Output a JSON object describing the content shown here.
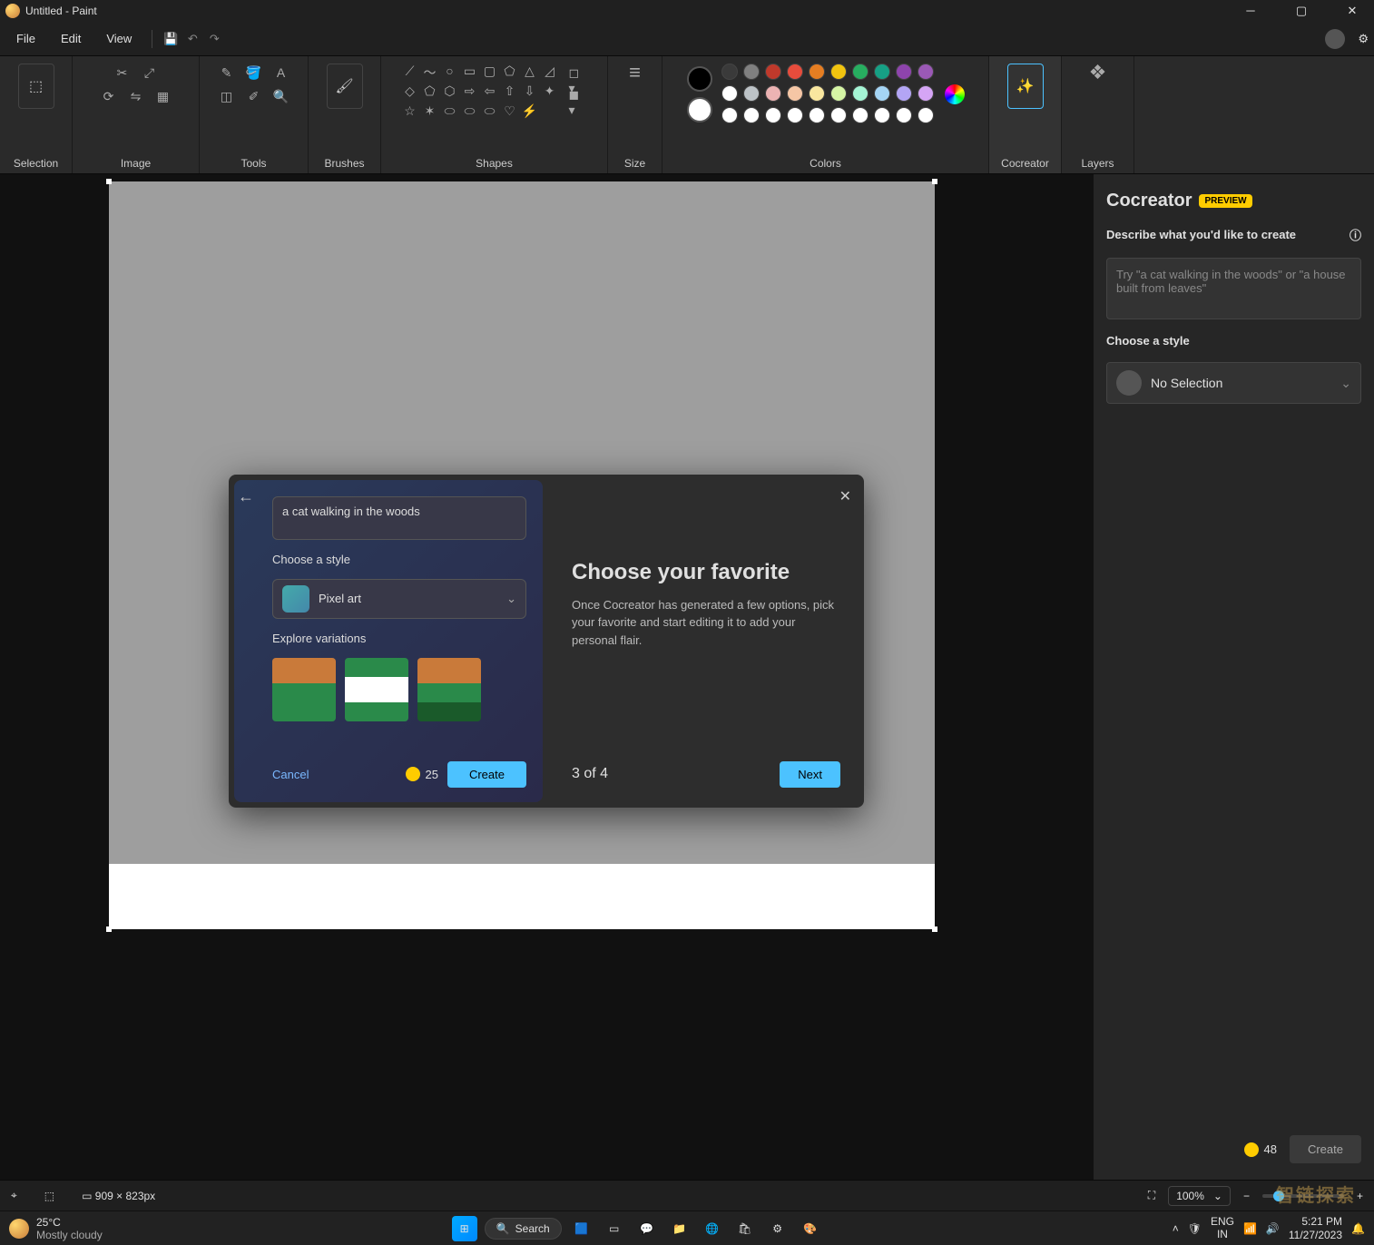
{
  "window": {
    "title": "Untitled - Paint"
  },
  "menubar": {
    "file": "File",
    "edit": "Edit",
    "view": "View"
  },
  "ribbon": {
    "selection": "Selection",
    "image": "Image",
    "tools": "Tools",
    "brushes": "Brushes",
    "shapes": "Shapes",
    "size": "Size",
    "colors": "Colors",
    "cocreator": "Cocreator",
    "layers": "Layers"
  },
  "ribbon_colors": {
    "selected1": "#000000",
    "selected2": "#ffffff",
    "row1": [
      "#3a3a3a",
      "#808080",
      "#c0392b",
      "#e74c3c",
      "#e67e22",
      "#f1c40f",
      "#27ae60",
      "#16a085",
      "#8e44ad",
      "#9b59b6"
    ],
    "row2": [
      "#ffffff",
      "#bdc3c7",
      "#ecb3b3",
      "#f5c6a5",
      "#f9e79f",
      "#d5f5a5",
      "#a5f5d5",
      "#a5d5f5",
      "#b3a5f5",
      "#d5a5f5"
    ],
    "row3": [
      "#ffffff",
      "#ffffff",
      "#ffffff",
      "#ffffff",
      "#ffffff",
      "#ffffff",
      "#ffffff",
      "#ffffff",
      "#ffffff",
      "#ffffff"
    ]
  },
  "cocreator_panel": {
    "title": "Cocreator",
    "badge": "PREVIEW",
    "prompt_label": "Describe what you'd like to create",
    "placeholder": "Try \"a cat walking in the woods\" or \"a house built from leaves\"",
    "style_label": "Choose a style",
    "style_value": "No Selection",
    "credits": "48",
    "create": "Create"
  },
  "modal": {
    "prompt_value": "a cat walking in the woods",
    "style_label": "Choose a style",
    "style_value": "Pixel art",
    "explore": "Explore variations",
    "cancel": "Cancel",
    "credits": "25",
    "create": "Create",
    "right_title": "Choose your favorite",
    "right_body": "Once Cocreator has generated a few options, pick your favorite and start editing it to add your personal flair.",
    "step": "3 of 4",
    "next": "Next"
  },
  "statusbar": {
    "cursor_icon": "⌖",
    "dims": "909 × 823px",
    "zoom": "100%"
  },
  "taskbar": {
    "temp": "25°C",
    "cond": "Mostly cloudy",
    "search": "Search",
    "lang1": "ENG",
    "lang2": "IN",
    "time": "5:21 PM",
    "date": "11/27/2023"
  },
  "watermark": "智链探索"
}
